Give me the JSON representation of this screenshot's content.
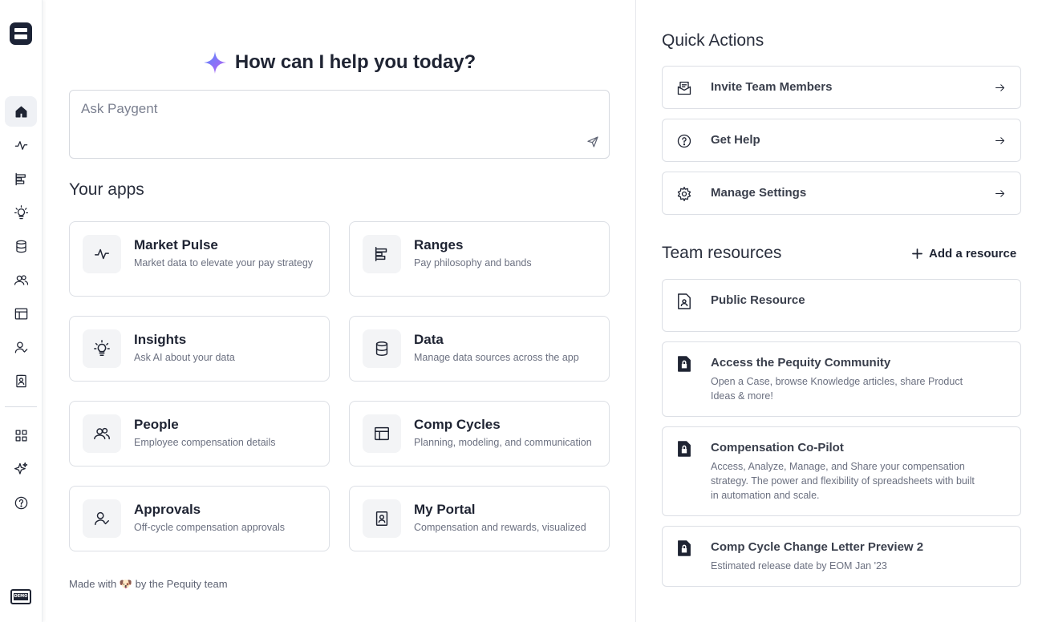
{
  "sidebar": {
    "items": [
      {
        "name": "home",
        "icon": "home-icon",
        "active": true
      },
      {
        "name": "market-pulse",
        "icon": "pulse-icon",
        "active": false
      },
      {
        "name": "ranges",
        "icon": "ranges-icon",
        "active": false
      },
      {
        "name": "insights",
        "icon": "lightbulb-icon",
        "active": false
      },
      {
        "name": "data",
        "icon": "database-icon",
        "active": false
      },
      {
        "name": "people",
        "icon": "people-icon",
        "active": false
      },
      {
        "name": "comp-cycles",
        "icon": "layout-icon",
        "active": false
      },
      {
        "name": "approvals",
        "icon": "user-check-icon",
        "active": false
      },
      {
        "name": "my-portal",
        "icon": "badge-icon",
        "active": false
      },
      {
        "name": "all-apps",
        "icon": "grid-icon",
        "active": false
      },
      {
        "name": "ai",
        "icon": "sparkle-icon",
        "active": false
      },
      {
        "name": "help",
        "icon": "help-icon",
        "active": false
      }
    ],
    "demo_badge": "DEMO"
  },
  "main": {
    "heading": "How can I help you today?",
    "ask_placeholder": "Ask Paygent",
    "apps_title": "Your apps",
    "apps": [
      {
        "name": "Market Pulse",
        "desc": "Market data to elevate your pay strategy",
        "icon": "pulse-icon"
      },
      {
        "name": "Ranges",
        "desc": "Pay philosophy and bands",
        "icon": "ranges-icon"
      },
      {
        "name": "Insights",
        "desc": "Ask AI about your data",
        "icon": "lightbulb-icon"
      },
      {
        "name": "Data",
        "desc": "Manage data sources across the app",
        "icon": "database-icon"
      },
      {
        "name": "People",
        "desc": "Employee compensation details",
        "icon": "people-icon"
      },
      {
        "name": "Comp Cycles",
        "desc": "Planning, modeling, and communication",
        "icon": "layout-icon"
      },
      {
        "name": "Approvals",
        "desc": "Off-cycle compensation approvals",
        "icon": "user-check-icon"
      },
      {
        "name": "My Portal",
        "desc": "Compensation and rewards, visualized",
        "icon": "badge-icon"
      }
    ],
    "footer": "Made with 🐶 by the Pequity team"
  },
  "right": {
    "quick_actions_title": "Quick Actions",
    "quick_actions": [
      {
        "label": "Invite Team Members",
        "icon": "envelope-icon"
      },
      {
        "label": "Get Help",
        "icon": "help-icon"
      },
      {
        "label": "Manage Settings",
        "icon": "gear-icon"
      }
    ],
    "team_resources_title": "Team resources",
    "add_resource_label": "Add a resource",
    "resources": [
      {
        "title": "Public Resource",
        "desc": "",
        "icon": "document-icon"
      },
      {
        "title": "Access the Pequity Community",
        "desc": "Open a Case, browse Knowledge articles, share Product Ideas & more!",
        "icon": "locked-document-icon"
      },
      {
        "title": "Compensation Co-Pilot",
        "desc": "Access, Analyze, Manage, and Share your compensation strategy. The power and flexibility of spreadsheets with built in automation and scale.",
        "icon": "locked-document-icon"
      },
      {
        "title": "Comp Cycle Change Letter Preview 2",
        "desc": "Estimated release date by EOM Jan '23",
        "icon": "locked-document-icon"
      }
    ]
  },
  "colors": {
    "text": "#1f2433",
    "muted": "#6b7080",
    "border": "#dcdfe5",
    "active_bg": "#eff1f5",
    "spark_start": "#4f8cff",
    "spark_end": "#c05cf0"
  }
}
